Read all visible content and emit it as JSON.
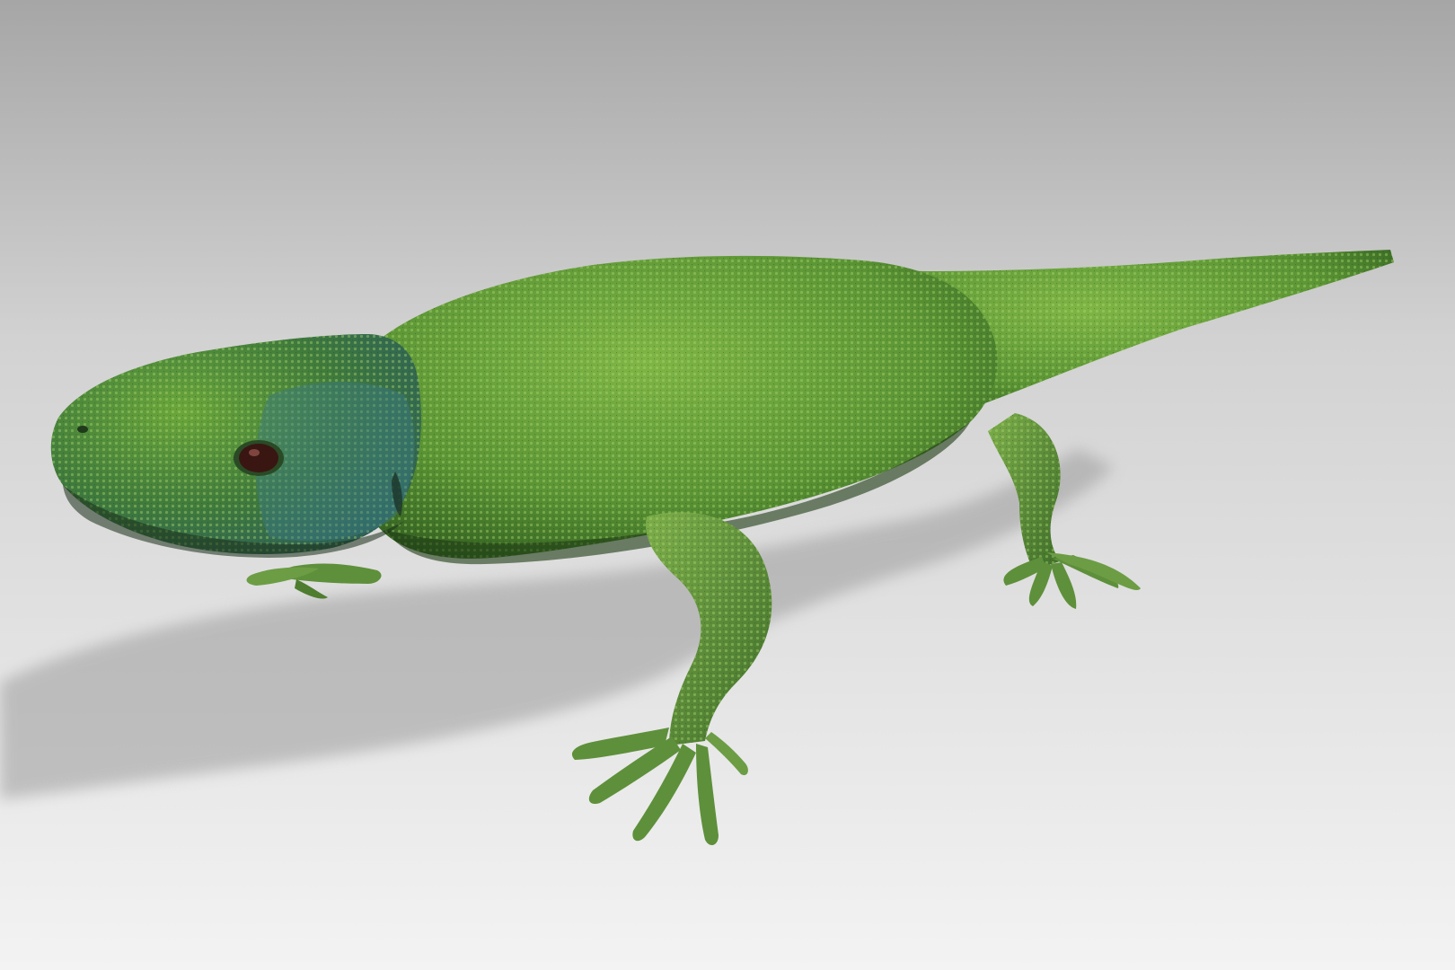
{
  "scene": {
    "subject": "green-lizard-3d-model",
    "colors": {
      "background_top": "#a9a9a9",
      "background_bottom": "#f2f2f2",
      "skin_base": "#5c9a35",
      "skin_light": "#8cc04e",
      "skin_dark": "#2f5a1e",
      "head_blue": "#3f7f82",
      "eye": "#3a1612",
      "shadow": "#9a9a9a"
    }
  }
}
